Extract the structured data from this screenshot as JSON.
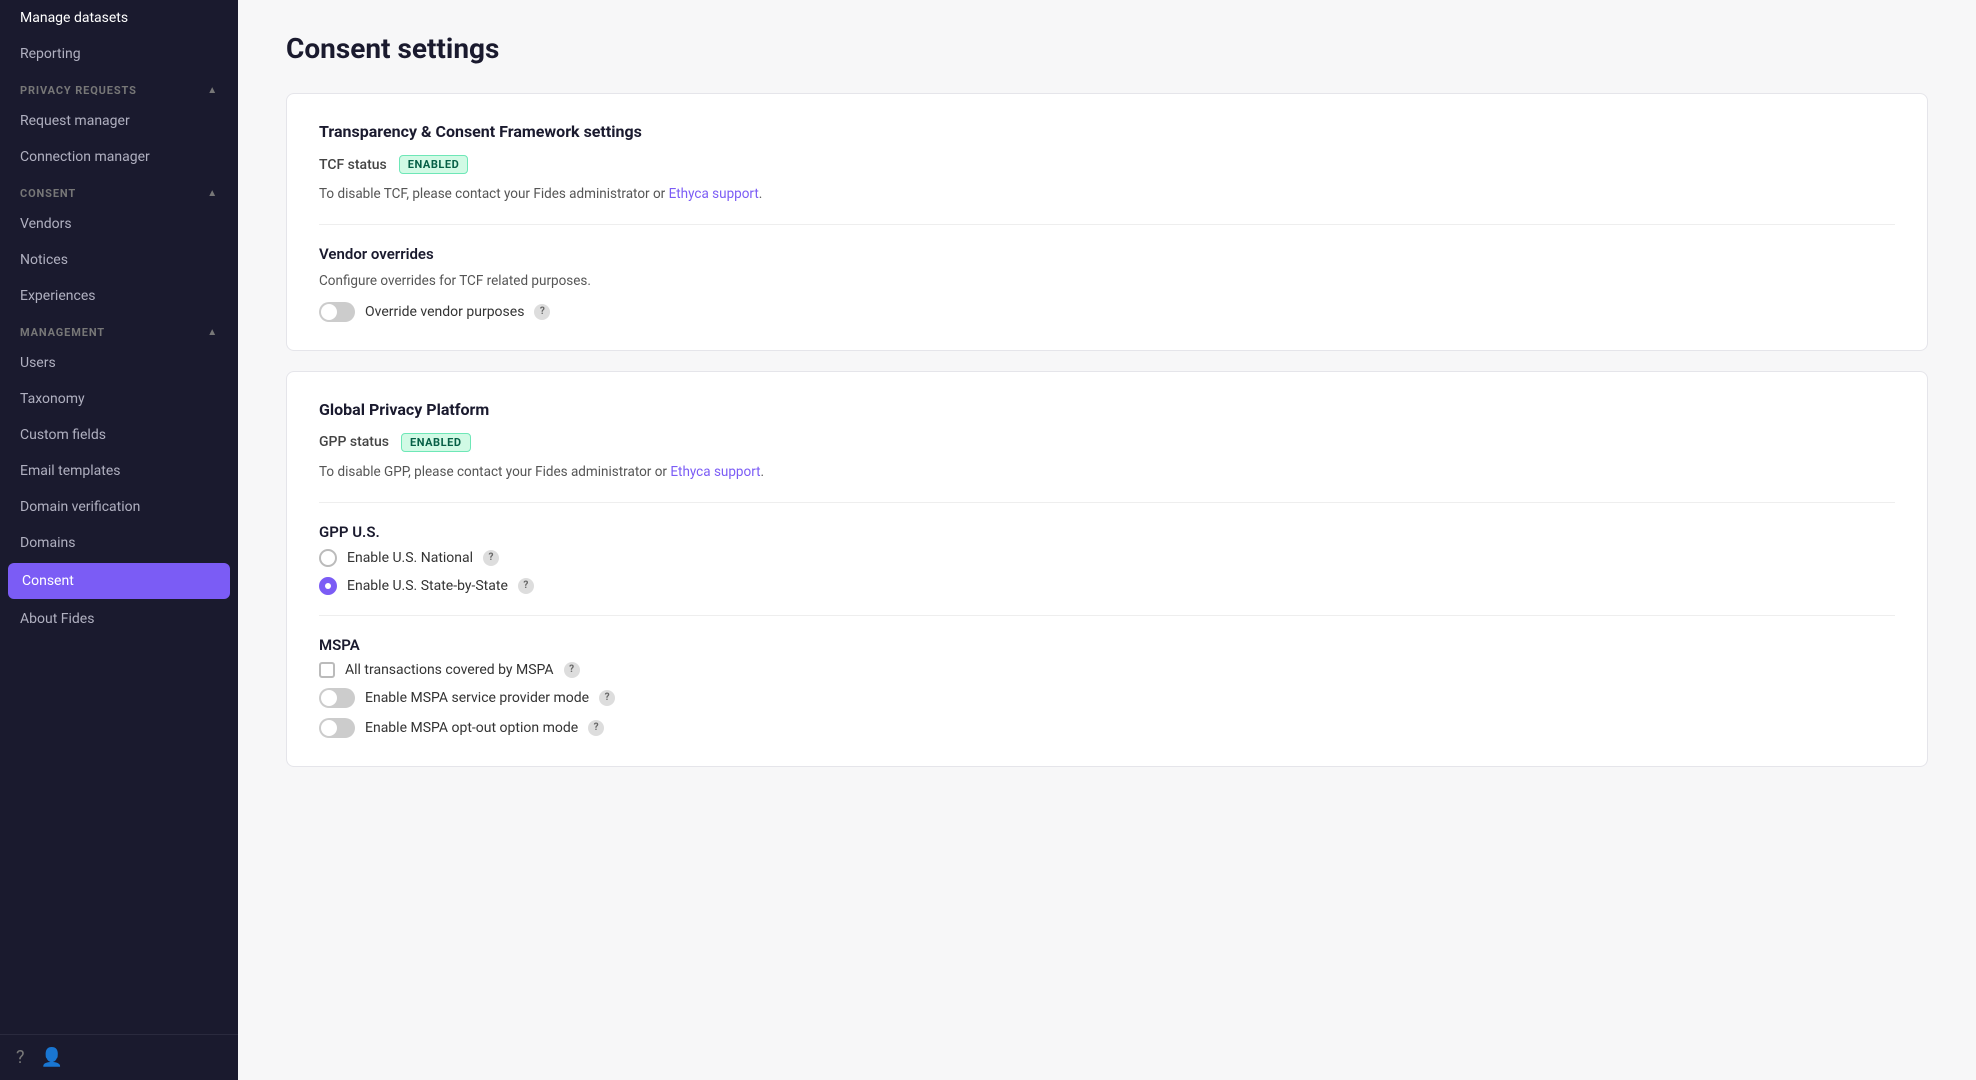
{
  "sidebar": {
    "items": [
      {
        "id": "manage-datasets",
        "label": "Manage datasets",
        "active": false
      },
      {
        "id": "reporting",
        "label": "Reporting",
        "active": false
      },
      {
        "id": "privacy-requests-header",
        "label": "PRIVACY REQUESTS",
        "type": "section"
      },
      {
        "id": "request-manager",
        "label": "Request manager",
        "active": false
      },
      {
        "id": "connection-manager",
        "label": "Connection manager",
        "active": false
      },
      {
        "id": "consent-header",
        "label": "CONSENT",
        "type": "section"
      },
      {
        "id": "vendors",
        "label": "Vendors",
        "active": false
      },
      {
        "id": "notices",
        "label": "Notices",
        "active": false
      },
      {
        "id": "experiences",
        "label": "Experiences",
        "active": false
      },
      {
        "id": "management-header",
        "label": "MANAGEMENT",
        "type": "section"
      },
      {
        "id": "users",
        "label": "Users",
        "active": false
      },
      {
        "id": "taxonomy",
        "label": "Taxonomy",
        "active": false
      },
      {
        "id": "custom-fields",
        "label": "Custom fields",
        "active": false
      },
      {
        "id": "email-templates",
        "label": "Email templates",
        "active": false
      },
      {
        "id": "domain-verification",
        "label": "Domain verification",
        "active": false
      },
      {
        "id": "domains",
        "label": "Domains",
        "active": false
      },
      {
        "id": "consent",
        "label": "Consent",
        "active": true
      },
      {
        "id": "about-fides",
        "label": "About Fides",
        "active": false
      }
    ]
  },
  "page": {
    "title": "Consent settings",
    "cards": {
      "tcf": {
        "title": "Transparency & Consent Framework settings",
        "status_label": "TCF status",
        "status_badge": "ENABLED",
        "info_text": "To disable TCF, please contact your Fides administrator or ",
        "link_text": "Ethyca support",
        "info_text_end": ".",
        "vendor_overrides": {
          "title": "Vendor overrides",
          "description": "Configure overrides for TCF related purposes.",
          "toggle_label": "Override vendor purposes",
          "toggle_on": false
        }
      },
      "gpp": {
        "title": "Global Privacy Platform",
        "status_label": "GPP status",
        "status_badge": "ENABLED",
        "info_text": "To disable GPP, please contact your Fides administrator or ",
        "link_text": "Ethyca support",
        "info_text_end": ".",
        "gpp_us": {
          "title": "GPP U.S.",
          "options": [
            {
              "id": "us-national",
              "label": "Enable U.S. National",
              "selected": false
            },
            {
              "id": "us-state",
              "label": "Enable U.S. State-by-State",
              "selected": true
            }
          ]
        },
        "mspa": {
          "title": "MSPA",
          "checkbox": {
            "label": "All transactions covered by MSPA",
            "checked": false
          },
          "toggles": [
            {
              "id": "mspa-service",
              "label": "Enable MSPA service provider mode",
              "on": false
            },
            {
              "id": "mspa-optout",
              "label": "Enable MSPA opt-out option mode",
              "on": false
            }
          ]
        }
      }
    }
  },
  "icons": {
    "chevron_up": "▲",
    "question": "?",
    "help_circle": "?",
    "user": "👤",
    "info": "ℹ"
  }
}
